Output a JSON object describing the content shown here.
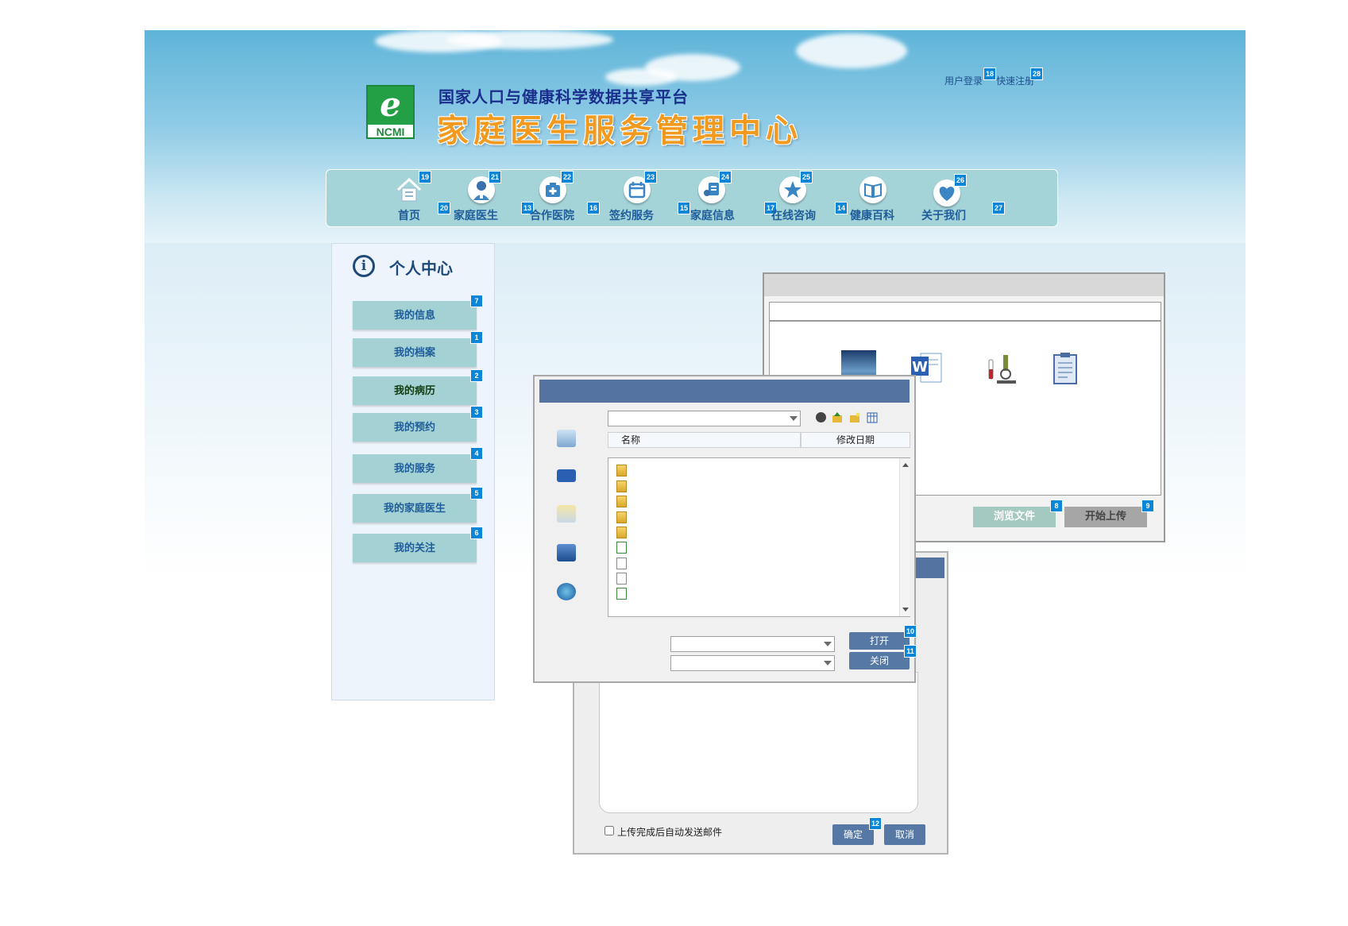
{
  "header": {
    "logo_text": "NCMI",
    "platform_name": "国家人口与健康科学数据共享平台",
    "center_name": "家庭医生服务管理中心",
    "login_label": "用户登录",
    "register_label": "快速注册"
  },
  "nav": {
    "items": [
      {
        "label": "首页",
        "icon": "home-icon"
      },
      {
        "label": "家庭医生",
        "icon": "doctor-icon"
      },
      {
        "label": "合作医院",
        "icon": "hospital-icon"
      },
      {
        "label": "签约服务",
        "icon": "calendar-icon"
      },
      {
        "label": "家庭信息",
        "icon": "family-info-icon"
      },
      {
        "label": "在线咨询",
        "icon": "star-chat-icon"
      },
      {
        "label": "健康百科",
        "icon": "book-icon"
      },
      {
        "label": "关于我们",
        "icon": "handshake-icon"
      }
    ]
  },
  "sidebar": {
    "title": "个人中心",
    "items": [
      "我的信息",
      "我的档案",
      "我的病历",
      "我的预约",
      "我的服务",
      "我的家庭医生",
      "我的关注"
    ],
    "active_index": 2
  },
  "upload": {
    "browse_label": "浏览文件",
    "start_label": "开始上传"
  },
  "file_dialog": {
    "col_name": "名称",
    "col_modified": "修改日期",
    "open_label": "打开",
    "close_label": "关闭"
  },
  "mail_dialog": {
    "auto_email_label": "上传完成后自动发送邮件",
    "ok_label": "确定",
    "cancel_label": "取消"
  },
  "badges": {
    "login": "18",
    "register": "28",
    "nav_home": "19",
    "nav_doctor": "21",
    "nav_hospital": "22",
    "nav_sign": "23",
    "nav_family": "24",
    "nav_consult": "25",
    "nav_about": "26",
    "nav_gap1": "20",
    "nav_gap2": "13",
    "nav_gap3": "16",
    "nav_gap4": "15",
    "nav_gap5": "17",
    "nav_gap6": "14",
    "nav_gap7": "27",
    "side_info": "7",
    "side_archive": "1",
    "side_record": "2",
    "side_appoint": "3",
    "side_service": "4",
    "side_family_doctor": "5",
    "side_follow": "6",
    "browse": "8",
    "start": "9",
    "open": "10",
    "close": "11",
    "ok": "12"
  },
  "colors": {
    "nav_bg": "#a4d3d8",
    "nav_text": "#1f5d9a",
    "sidebar_btn": "#a4d1d4",
    "dialog_header": "#5573a0",
    "title_orange": "#f29a1f",
    "platform_blue": "#1a2e8c",
    "badge_blue": "#0a86d8"
  }
}
